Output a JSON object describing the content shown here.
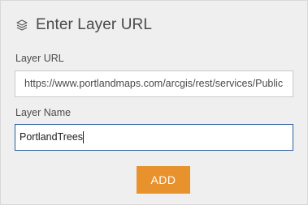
{
  "dialog": {
    "title": "Enter Layer URL",
    "title_icon": "layers-icon"
  },
  "layer_url": {
    "label": "Layer URL",
    "value": "https://www.portlandmaps.com/arcgis/rest/services/Public"
  },
  "layer_name": {
    "label": "Layer Name",
    "value": "PortlandTrees"
  },
  "actions": {
    "add_label": "ADD"
  },
  "colors": {
    "accent": "#e8922e",
    "focus_border": "#2b5f9e",
    "panel_bg": "#efefef"
  }
}
